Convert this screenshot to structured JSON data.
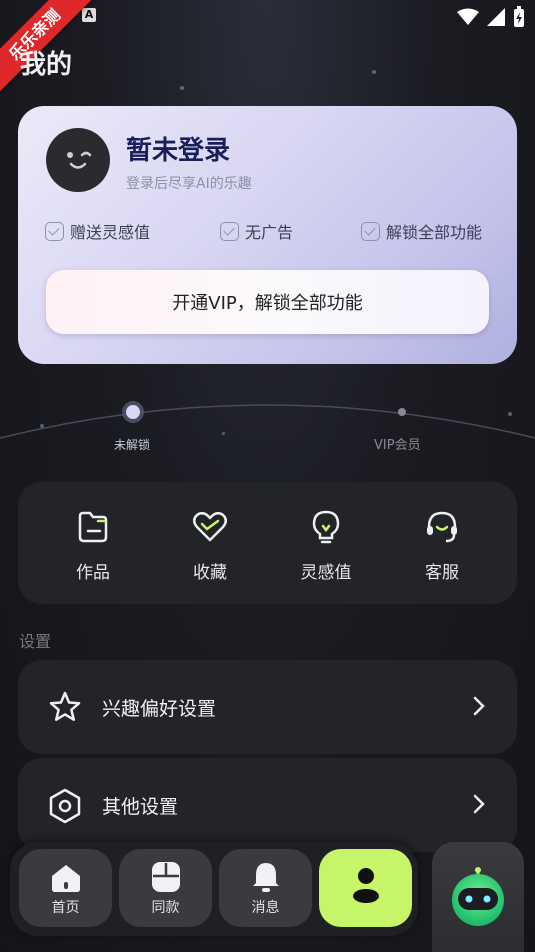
{
  "status": {
    "a_badge": "A"
  },
  "ribbon": {
    "text": "乐乐亲测"
  },
  "page": {
    "title": "我的"
  },
  "profile": {
    "title": "暂未登录",
    "subtitle": "登录后尽享AI的乐趣"
  },
  "perks": [
    "赠送灵感值",
    "无广告",
    "解锁全部功能"
  ],
  "vip_button": {
    "label": "开通VIP，解锁全部功能"
  },
  "progress": {
    "left_label": "未解锁",
    "right_label": "VIP会员"
  },
  "quick": [
    {
      "label": "作品",
      "icon": "works-icon"
    },
    {
      "label": "收藏",
      "icon": "favorite-heart-icon"
    },
    {
      "label": "灵感值",
      "icon": "lightbulb-icon"
    },
    {
      "label": "客服",
      "icon": "headset-icon"
    }
  ],
  "settings": {
    "section_label": "设置",
    "rows": [
      {
        "label": "兴趣偏好设置",
        "icon": "star-icon"
      },
      {
        "label": "其他设置",
        "icon": "hexagon-settings-icon"
      }
    ]
  },
  "nav": [
    {
      "label": "首页",
      "icon": "home-icon"
    },
    {
      "label": "同款",
      "icon": "same-style-icon"
    },
    {
      "label": "消息",
      "icon": "bell-icon"
    },
    {
      "label": "",
      "icon": "profile-icon",
      "active": true
    }
  ],
  "colors": {
    "accent": "#c6f569",
    "card_title": "#1a1f5a",
    "robot_face": "#2fe08a"
  }
}
